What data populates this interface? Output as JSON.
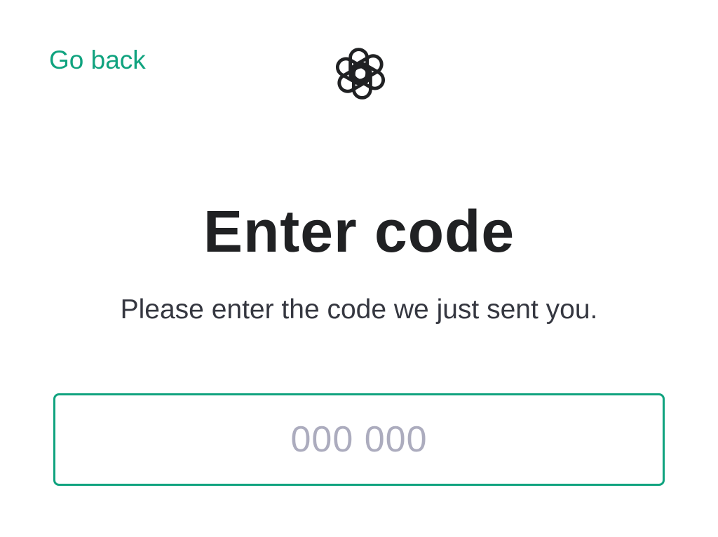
{
  "nav": {
    "back_label": "Go back"
  },
  "logo": {
    "icon": "openai-logo-icon"
  },
  "heading": {
    "title": "Enter code",
    "subtitle": "Please enter the code we just sent you."
  },
  "code_field": {
    "value": "",
    "placeholder": "000 000"
  },
  "colors": {
    "accent": "#10a37f",
    "title": "#202123",
    "subtitle": "#353740",
    "placeholder": "#acacbe"
  }
}
